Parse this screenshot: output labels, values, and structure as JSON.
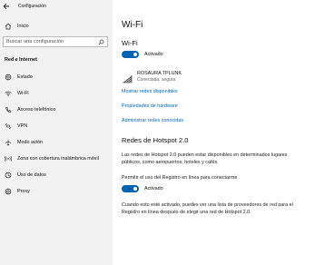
{
  "window": {
    "title": "Configuración"
  },
  "sidebar": {
    "home_label": "Inicio",
    "search_placeholder": "Buscar una configuración",
    "section_title": "Red e Internet",
    "items": [
      {
        "label": "Estado",
        "icon": "globe-icon"
      },
      {
        "label": "Wi-Fi",
        "icon": "wifi-icon"
      },
      {
        "label": "Acceso telefónico",
        "icon": "phone-icon"
      },
      {
        "label": "VPN",
        "icon": "vpn-icon"
      },
      {
        "label": "Modo avión",
        "icon": "airplane-icon"
      },
      {
        "label": "Zona con cobertura inalámbrica móvil",
        "icon": "hotspot-icon"
      },
      {
        "label": "Uso de datos",
        "icon": "data-usage-icon"
      },
      {
        "label": "Proxy",
        "icon": "globe-icon"
      }
    ]
  },
  "main": {
    "page_title": "Wi-Fi",
    "wifi_section_title": "Wi-Fi",
    "wifi_toggle_label": "Activado",
    "network": {
      "name": "ROSAURA TPLUNK",
      "status": "Conectada, segura"
    },
    "links": {
      "show_networks": "Mostrar redes disponibles",
      "hardware_properties": "Propiedades de hardware",
      "manage_known": "Administrar redes conocidas"
    },
    "hotspot": {
      "title": "Redes de Hotspot 2.0",
      "description": "Las redes de Hotspot 2.0 pueden estar disponibles en determinados lugares públicos, como aeropuertos, hoteles y cafés.",
      "permit_label": "Permitir el uso del Registro en línea para conectarme",
      "toggle_label": "Activado",
      "note": "Cuando esto esté activado, puedes ver una lista de proveedores de red para el Registro en línea después de elegir una red de Hotspot 2.0."
    }
  },
  "colors": {
    "accent": "#0063b1",
    "link": "#0066b4",
    "sidebar_bg": "#f2f2f2"
  }
}
